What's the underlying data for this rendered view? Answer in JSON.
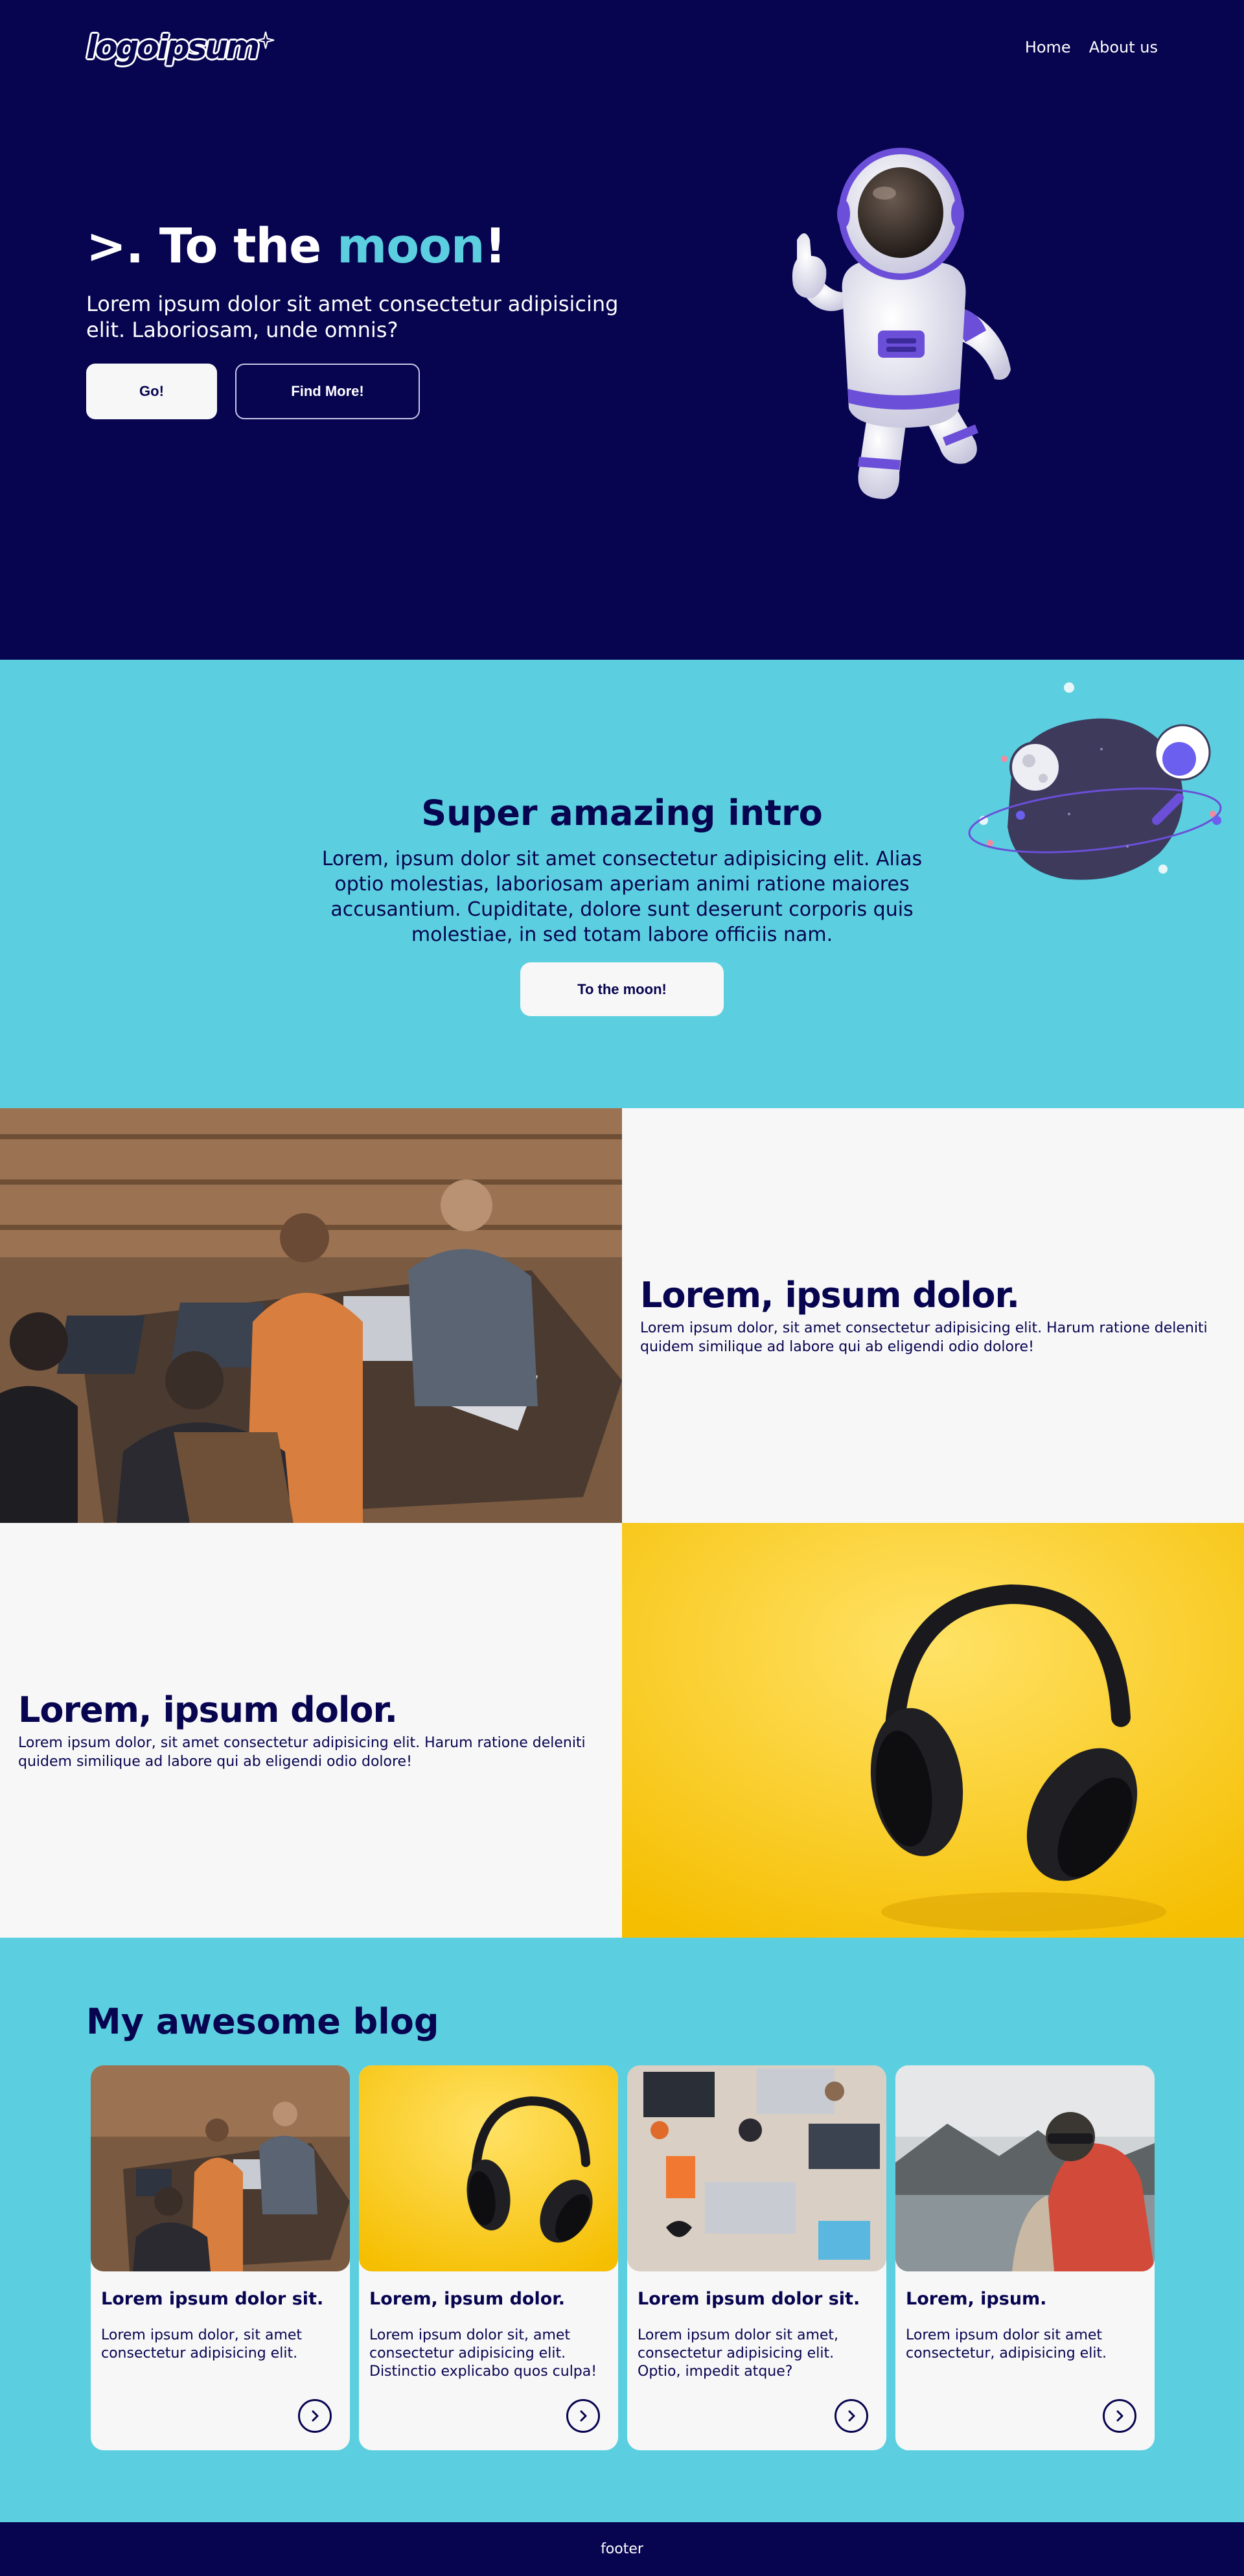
{
  "brand": {
    "logo_text": "logoipsum"
  },
  "nav": {
    "links": [
      "Home",
      "About us"
    ]
  },
  "hero": {
    "title_prefix": ">. To the ",
    "title_accent": "moon",
    "title_suffix": "!",
    "subtitle": "Lorem ipsum dolor sit amet consectetur adipisicing elit. Laboriosam, unde omnis?",
    "primary_button": "Go!",
    "secondary_button": "Find More!"
  },
  "intro": {
    "title": "Super amazing intro",
    "text": "Lorem, ipsum dolor sit amet consectetur adipisicing elit. Alias optio molestias, laboriosam aperiam animi ratione maiores accusantium. Cupiditate, dolore sunt deserunt corporis quis molestiae, in sed totam labore officiis nam.",
    "button": "To the moon!"
  },
  "features": [
    {
      "title": "Lorem, ipsum dolor.",
      "text": "Lorem ipsum dolor, sit amet consectetur adipisicing elit. Harum ratione deleniti quidem similique ad labore qui ab eligendi odio dolore!"
    },
    {
      "title": "Lorem, ipsum dolor.",
      "text": "Lorem ipsum dolor, sit amet consectetur adipisicing elit. Harum ratione deleniti quidem similique ad labore qui ab eligendi odio dolore!"
    }
  ],
  "blog": {
    "title": "My awesome blog",
    "posts": [
      {
        "title": "Lorem ipsum dolor sit.",
        "text": "Lorem ipsum dolor, sit amet consectetur adipisicing elit."
      },
      {
        "title": "Lorem, ipsum dolor.",
        "text": "Lorem ipsum dolor sit, amet consectetur adipisicing elit. Distinctio explicabo quos culpa!"
      },
      {
        "title": "Lorem ipsum dolor sit.",
        "text": "Lorem ipsum dolor sit amet, consectetur adipisicing elit. Optio, impedit atque?"
      },
      {
        "title": "Lorem, ipsum.",
        "text": "Lorem ipsum dolor sit amet consectetur, adipisicing elit."
      }
    ]
  },
  "footer": {
    "text": "footer"
  },
  "colors": {
    "navy": "#070450",
    "cyan": "#5bcfe0",
    "offwhite": "#f7f7f7",
    "purple": "#6b4fd8"
  },
  "icons": {
    "card_arrow": "chevron-right-circle-icon",
    "logo_star": "sparkle-icon"
  }
}
